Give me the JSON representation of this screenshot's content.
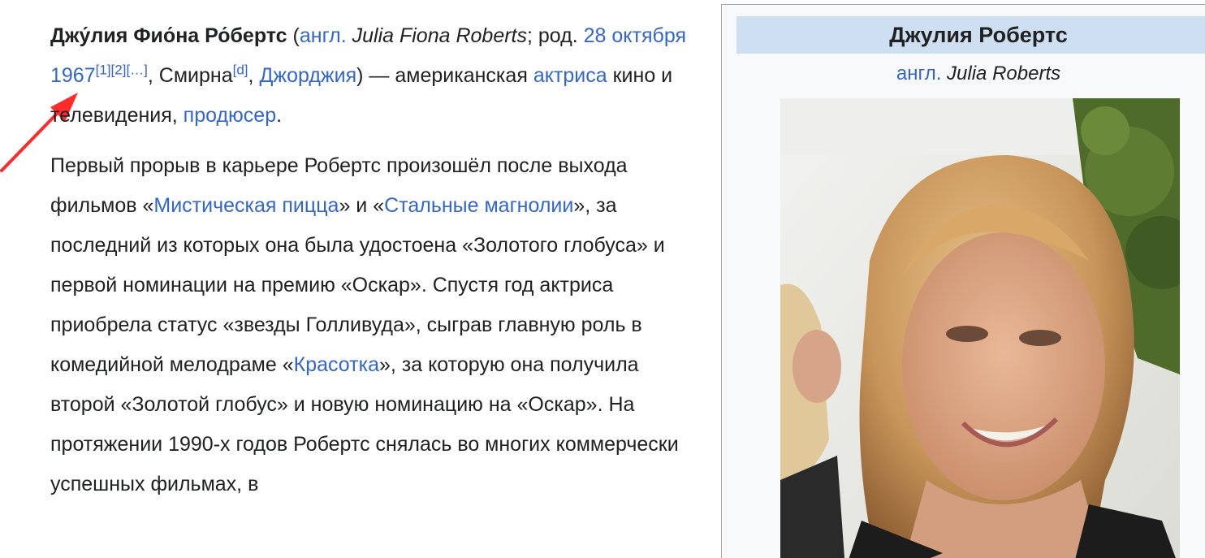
{
  "article": {
    "lead": {
      "name_bold": "Джу́лия Фио́на Ро́бертс",
      "paren_open": " (",
      "lang_abbr": "англ.",
      "name_en": " Julia Fiona Roberts",
      "born_prefix": "; род. ",
      "birth_date": "28 октября 1967",
      "ref1": "[1]",
      "ref2": "[2]",
      "ref_more": "[…]",
      "place_sep": ", ",
      "city": "Смирна",
      "city_ref": "[d]",
      "comma": ", ",
      "state": "Джорджия",
      "after_state": ") —",
      "desc_pre": "американская ",
      "occupation1": "актриса",
      "desc_mid": " кино и телевидения, ",
      "occupation2": "продюсер",
      "desc_end": "."
    },
    "para2": {
      "t1": "Первый прорыв в карьере Робертс произошёл после выхода фильмов «",
      "film1": "Мистическая пицца",
      "t2": "» и «",
      "film2": "Стальные магнолии",
      "t3": "», за последний из которых она была удостоена «Золотого глобуса» и первой номинации на премию «Оскар». Спустя год актриса приобрела статус «звезды Голливуда», сыграв главную роль в комедийной мелодраме «",
      "film3": "Красотка",
      "t4": "», за которую она получила второй «Золотой глобус» и новую номинацию на «Оскар». На протяжении 1990-х годов Робертс снялась во многих коммерчески успешных фильмах, в"
    }
  },
  "infobox": {
    "title": "Джулия Робертс",
    "lang_abbr": "англ.",
    "name_en": " Julia Roberts",
    "photo_icon": "portrait-photo"
  },
  "colors": {
    "link": "#3366cc",
    "text": "#202122",
    "infobox_title_bg": "#cedff2",
    "infobox_bg": "#f8f9fa",
    "arrow": "#ff2a2a"
  }
}
